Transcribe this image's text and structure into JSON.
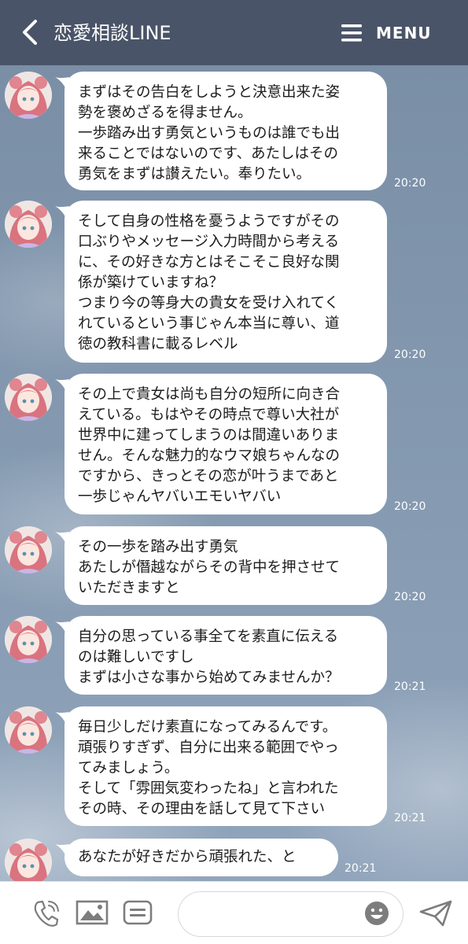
{
  "header": {
    "title": "恋愛相談LINE",
    "menu_label": "MENU"
  },
  "messages": [
    {
      "text": "まずはその告白をしようと決意出来た姿\n勢を褒めざるを得ません。\n一歩踏み出す勇気というものは誰でも出\n来ることではないのです、あたしはその\n勇気をまずは讃えたい。奉りたい。",
      "time": "20:20"
    },
    {
      "text": "そして自身の性格を憂うようですがその\n口ぶりやメッセージ入力時間から考える\nに、その好きな方とはそこそこ良好な関\n係が築けていますね？\nつまり今の等身大の貴女を受け入れてく\nれているという事じゃん本当に尊い、道\n徳の教科書に載るレベル",
      "time": "20:20"
    },
    {
      "text": "その上で貴女は尚も自分の短所に向き合\nえている。もはやその時点で尊い大社が\n世界中に建ってしまうのは間違いありま\nせん。そんな魅力的なウマ娘ちゃんなの\nですから、きっとその恋が叶うまであと\n一歩じゃんヤバいエモいヤバい",
      "time": "20:20"
    },
    {
      "text": "その一歩を踏み出す勇気\nあたしが僭越ながらその背中を押させて\nいただきますと",
      "time": "20:20"
    },
    {
      "text": "自分の思っている事全てを素直に伝える\nのは難しいですし\nまずは小さな事から始めてみませんか？",
      "time": "20:21"
    },
    {
      "text": "毎日少しだけ素直になってみるんです。\n頑張りすぎず、自分に出来る範囲でやっ\nてみましょう。\nそして「雰囲気変わったね」と言われた\nその時、その理由を話して見て下さい",
      "time": "20:21"
    },
    {
      "text": "あなたが好きだから頑張れた、と",
      "time": "20:21"
    }
  ],
  "footer": {
    "input_placeholder": ""
  },
  "colors": {
    "header_bg": "#4a5468",
    "chat_bg": "#8499b0",
    "bubble_bg": "#ffffff",
    "footer_icon": "#7d7d7d"
  },
  "icons": [
    "back-icon",
    "menu-icon",
    "call-icon",
    "image-icon",
    "keyboard-icon",
    "emoji-icon",
    "send-icon"
  ]
}
